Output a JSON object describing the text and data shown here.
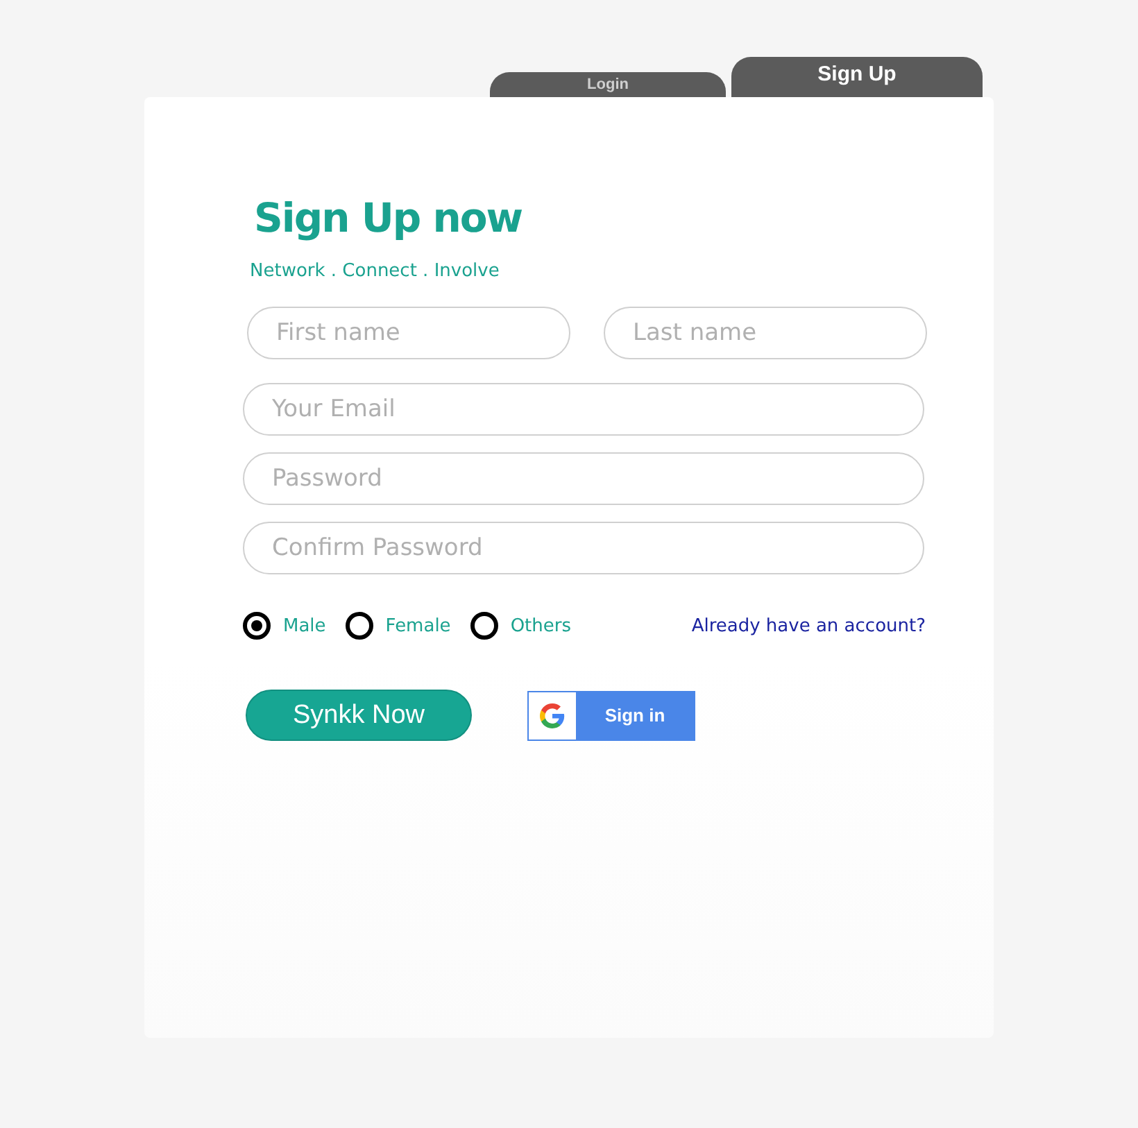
{
  "tabs": [
    {
      "label": "Login",
      "selected": false
    },
    {
      "label": "Sign Up",
      "selected": true
    }
  ],
  "title": "Sign Up now",
  "tagline": "Network . Connect . Involve",
  "name_fields": [
    {
      "placeholder": "First name"
    },
    {
      "placeholder": "Last name"
    }
  ],
  "fields": [
    {
      "placeholder": "Your Email"
    },
    {
      "placeholder": "Password"
    },
    {
      "placeholder": "Confirm Password"
    }
  ],
  "gender": [
    {
      "label": "Male",
      "selected": true
    },
    {
      "label": "Female",
      "selected": false
    },
    {
      "label": "Others",
      "selected": false
    }
  ],
  "account_link": "Already have an account?",
  "submit_button": "Synkk Now",
  "google_button": "Sign in"
}
